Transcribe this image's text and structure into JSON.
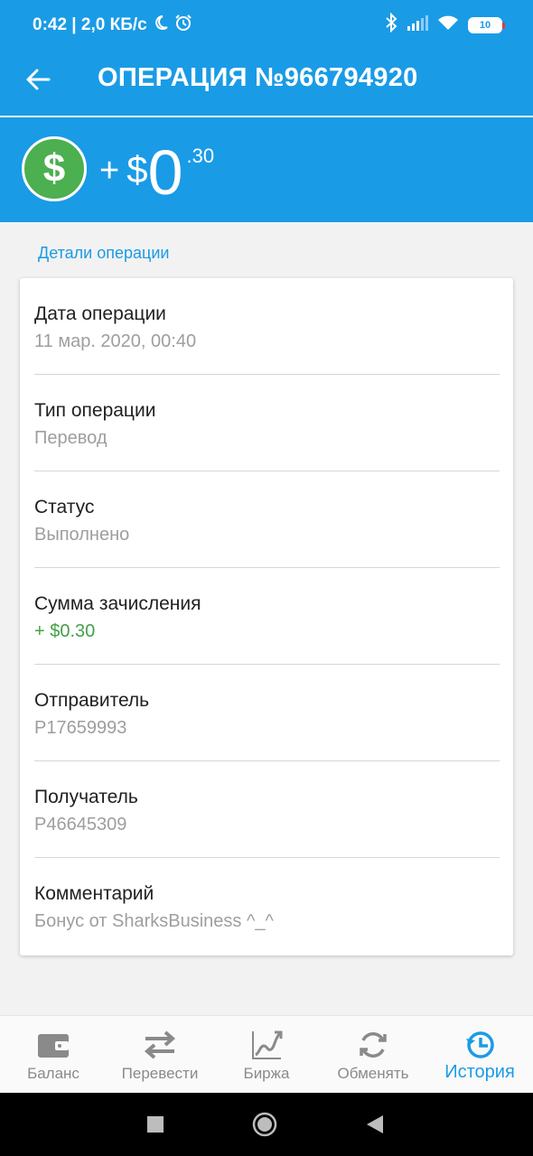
{
  "status_bar": {
    "time_and_speed": "0:42 | 2,0 КБ/с",
    "battery_level": "10"
  },
  "app_bar": {
    "title": "ОПЕРАЦИЯ №966794920"
  },
  "amount": {
    "sign": "+",
    "currency": "$",
    "integer": "0",
    "decimal": ".30",
    "icon": "dollar-coin-icon",
    "icon_color": "#4caf50"
  },
  "section_label": "Детали операции",
  "details": [
    {
      "label": "Дата операции",
      "value": "11 мар. 2020, 00:40"
    },
    {
      "label": "Тип операции",
      "value": "Перевод"
    },
    {
      "label": "Статус",
      "value": "Выполнено"
    },
    {
      "label": "Сумма зачисления",
      "value": "+ $0.30"
    },
    {
      "label": "Отправитель",
      "value": "P17659993"
    },
    {
      "label": "Получатель",
      "value": "P46645309"
    },
    {
      "label": "Комментарий",
      "value": "Бонус от SharksBusiness ^_^"
    }
  ],
  "bottom_nav": [
    {
      "label": "Баланс",
      "icon": "wallet-icon",
      "active": false
    },
    {
      "label": "Перевести",
      "icon": "transfer-arrows-icon",
      "active": false
    },
    {
      "label": "Биржа",
      "icon": "chart-icon",
      "active": false
    },
    {
      "label": "Обменять",
      "icon": "exchange-icon",
      "active": false
    },
    {
      "label": "История",
      "icon": "history-icon",
      "active": true
    }
  ],
  "colors": {
    "primary": "#1a9be6",
    "positive": "#43a047",
    "inactive": "#8a8a8a"
  }
}
